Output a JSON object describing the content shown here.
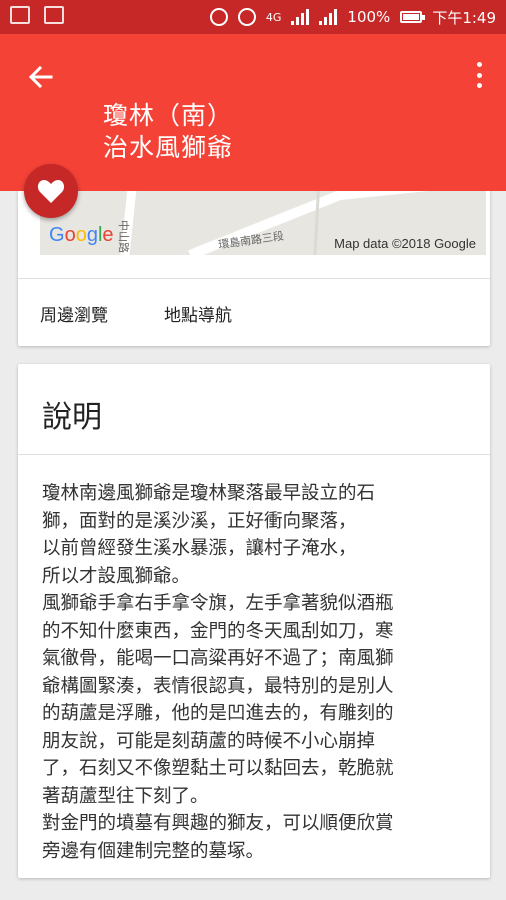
{
  "status_bar": {
    "left_icons": [
      "image-icon",
      "image-icon"
    ],
    "network_label": "4G",
    "battery": "100%",
    "time": "下午1:49"
  },
  "app_bar": {
    "title_line1": "瓊林（南）",
    "title_line2": "治水風獅爺"
  },
  "map": {
    "road_labels": [
      "中山路",
      "環島南路三段"
    ],
    "logo": "Google",
    "attribution": "Map data ©2018 Google"
  },
  "actions": {
    "nearby_label": "周邊瀏覽",
    "navigate_label": "地點導航"
  },
  "description": {
    "heading": "說明",
    "body": "瓊林南邊風獅爺是瓊林聚落最早設立的石\n獅，面對的是溪沙溪，正好衝向聚落，\n以前曾經發生溪水暴漲，讓村子淹水，\n所以才設風獅爺。\n風獅爺手拿右手拿令旗，左手拿著貌似酒瓶\n的不知什麼東西，金門的冬天風刮如刀，寒\n氣徹骨，能喝一口高粱再好不過了；南風獅\n爺構圖緊湊，表情很認真，最特別的是別人\n的葫蘆是浮雕，他的是凹進去的，有雕刻的\n朋友說，可能是刻葫蘆的時候不小心崩掉\n了，石刻又不像塑黏土可以黏回去，乾脆就\n著葫蘆型往下刻了。\n對金門的墳墓有興趣的獅友，可以順便欣賞\n旁邊有個建制完整的墓塚。"
  },
  "colors": {
    "status_bar": "#c62828",
    "app_bar": "#f44336",
    "fab": "#c62828"
  }
}
